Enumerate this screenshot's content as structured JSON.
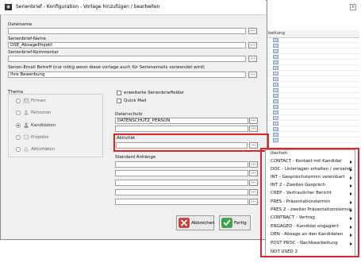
{
  "window": {
    "title": "Serienbrief - Konfiguration - Vorlage hinzufügen / bearbeiten",
    "icon": "app-icon"
  },
  "fields": {
    "dateiname": {
      "label": "Dateiname",
      "value": ""
    },
    "serienbrief_name": {
      "label": "Serienbrief-Name",
      "value": "DSE_AbsageProjekt"
    },
    "serienbrief_kommentar": {
      "label": "Serienbrief-Kommentar",
      "value": ""
    },
    "email_betreff": {
      "label": "Serien-Email Betreff (nur nötig wenn diese vorlage auch für Serienemails verwendet wird)",
      "value": "Ihre Bewerbung"
    },
    "datenschutz": {
      "label": "Datenschutz",
      "value": "DATENSCHUTZ_PERSON"
    },
    "aktivitaet": {
      "label": "Aktivität",
      "value": ""
    },
    "standard_anhaenge": {
      "label": "Standard Anhänge"
    }
  },
  "thema": {
    "label": "Thema",
    "options": [
      {
        "label": "Firmen",
        "selected": false,
        "icon": "building-icon"
      },
      {
        "label": "Personen",
        "selected": false,
        "icon": "person-icon"
      },
      {
        "label": "Kandidaten",
        "selected": true,
        "icon": "candidate-icon"
      },
      {
        "label": "Projekte",
        "selected": false,
        "icon": "project-icon"
      },
      {
        "label": "Aktivitäten",
        "selected": false,
        "icon": "activity-icon"
      }
    ]
  },
  "checkboxes": {
    "erweiterte": "erweiterte Serienbrieffelder",
    "quickmail": "Quick Mail"
  },
  "buttons": {
    "browse": "...",
    "abbrechen": "Abbrechen",
    "fertig": "Fertig"
  },
  "background": {
    "column_header": "beitung",
    "close": "x"
  },
  "context_menu": {
    "items": [
      {
        "label": "löschen",
        "submenu": false
      },
      {
        "label": "CONTACT - Kontakt mit Kandidat",
        "submenu": true
      },
      {
        "label": "DOC - Unterlagen erhalten / versandt",
        "submenu": true
      },
      {
        "label": "INT - Gespräichstermin vereinbart",
        "submenu": true
      },
      {
        "label": "INT 2 - Zweites Gespräch",
        "submenu": true
      },
      {
        "label": "CREP - Vertraulicher Bericht",
        "submenu": true
      },
      {
        "label": "PRES - Präsentationstermin",
        "submenu": true
      },
      {
        "label": "PRES 2 - zweiter Präsentationstermin",
        "submenu": true
      },
      {
        "label": "CONTRACT - Vertrag",
        "submenu": true
      },
      {
        "label": "ENGAGED - Kandidat engagiert",
        "submenu": true
      },
      {
        "label": "DEN - Absage an den Kandidaten",
        "submenu": true
      },
      {
        "label": "POST PROC - Nachbearbeitung",
        "submenu": true
      },
      {
        "label": "NOT USED 2",
        "submenu": false
      }
    ]
  },
  "colors": {
    "highlight": "#d62828",
    "dialog_bg": "#f0f0f0",
    "cancel": "#d23b3b",
    "ok": "#3aa24a"
  }
}
